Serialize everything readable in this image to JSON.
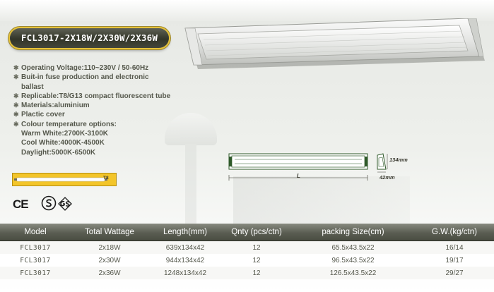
{
  "product": {
    "title": "FCL3017-2X18W/2X30W/2X36W"
  },
  "features": [
    "Operating Voltage:110~230V / 50-60Hz",
    "Buit-in fuse production and electronic",
    "ballast",
    "Replicable:T8/G13 compact fluorescent tube",
    "Materials:aluminium",
    "Plactic cover",
    "Colour temperature options:",
    "Warm White:2700K-3100K",
    "Cool White:4000K-4500K",
    "Daylight:5000K-6500K"
  ],
  "tube_label": "T8",
  "certifications": {
    "ce": "CE"
  },
  "dimensions": {
    "length_label": "L",
    "height_label": "134mm",
    "depth_label": "42mm"
  },
  "spec_table": {
    "headers": [
      "Model",
      "Total Wattage",
      "Length(mm)",
      "Qnty (pcs/ctn)",
      "packing Size(cm)",
      "G.W.(kg/ctn)"
    ],
    "rows": [
      [
        "FCL3017",
        "2x18W",
        "639x134x42",
        "12",
        "65.5x43.5x22",
        "16/14"
      ],
      [
        "FCL3017",
        "2x30W",
        "944x134x42",
        "12",
        "96.5x43.5x22",
        "19/17"
      ],
      [
        "FCL3017",
        "2x36W",
        "1248x134x42",
        "12",
        "126.5x43.5x22",
        "29/27"
      ]
    ]
  },
  "colors": {
    "title_pill": "#3a3d30",
    "pill_border": "#e6c23a",
    "table_header": "#5a5d52",
    "text": "#55584c",
    "tube_yellow": "#f3c52a"
  }
}
